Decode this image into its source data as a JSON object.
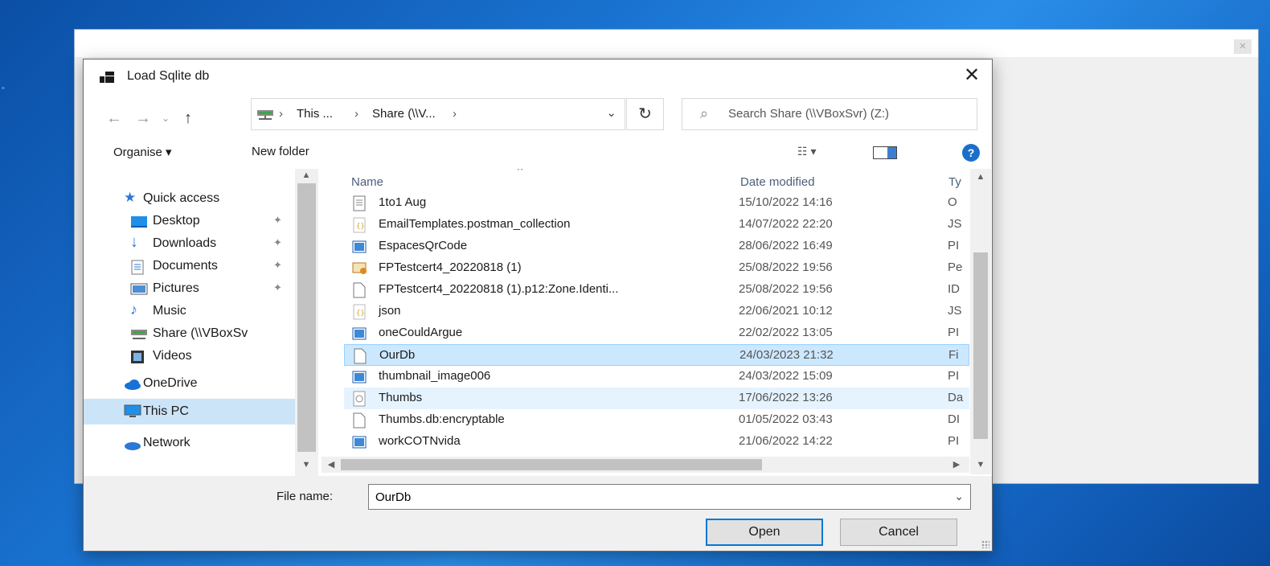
{
  "dialog": {
    "title": "Load Sqlite db",
    "address": {
      "crumbs": [
        "This ...",
        "Share (\\\\V...",
        ""
      ],
      "separator": "›"
    },
    "search": {
      "placeholder": "Search Share (\\\\VBoxSvr) (Z:)"
    },
    "toolbar": {
      "organise": "Organise ▾",
      "new_folder": "New folder"
    },
    "columns": {
      "name": "Name",
      "date": "Date modified",
      "type": "Ty"
    },
    "nav": {
      "quick_access": "Quick access",
      "items": [
        {
          "label": "Desktop",
          "icon": "desktop-icon",
          "pinned": true
        },
        {
          "label": "Downloads",
          "icon": "downloads-icon",
          "pinned": true
        },
        {
          "label": "Documents",
          "icon": "documents-icon",
          "pinned": true
        },
        {
          "label": "Pictures",
          "icon": "pictures-icon",
          "pinned": true
        },
        {
          "label": "Music",
          "icon": "music-icon",
          "pinned": false
        },
        {
          "label": "Share (\\\\VBoxSv",
          "icon": "network-drive-icon",
          "pinned": false
        },
        {
          "label": "Videos",
          "icon": "videos-icon",
          "pinned": false
        }
      ],
      "onedrive": "OneDrive",
      "this_pc": "This PC",
      "network": "Network"
    },
    "files": [
      {
        "name": "1to1 Aug",
        "date": "15/10/2022 14:16",
        "type": "O",
        "icon": "text-file-icon"
      },
      {
        "name": "EmailTemplates.postman_collection",
        "date": "14/07/2022 22:20",
        "type": "JS",
        "icon": "json-file-icon"
      },
      {
        "name": "EspacesQrCode",
        "date": "28/06/2022 16:49",
        "type": "PI",
        "icon": "image-file-icon"
      },
      {
        "name": "FPTestcert4_20220818 (1)",
        "date": "25/08/2022 19:56",
        "type": "Pe",
        "icon": "certificate-file-icon"
      },
      {
        "name": "FPTestcert4_20220818 (1).p12:Zone.Identi...",
        "date": "25/08/2022 19:56",
        "type": "ID",
        "icon": "blank-file-icon"
      },
      {
        "name": "json",
        "date": "22/06/2021 10:12",
        "type": "JS",
        "icon": "json-file-icon"
      },
      {
        "name": "oneCouldArgue",
        "date": "22/02/2022 13:05",
        "type": "PI",
        "icon": "image-file-icon"
      },
      {
        "name": "OurDb",
        "date": "24/03/2023 21:32",
        "type": "Fi",
        "icon": "blank-file-icon"
      },
      {
        "name": "thumbnail_image006",
        "date": "24/03/2022 15:09",
        "type": "PI",
        "icon": "image-file-icon"
      },
      {
        "name": "Thumbs",
        "date": "17/06/2022 13:26",
        "type": "Da",
        "icon": "database-file-icon"
      },
      {
        "name": "Thumbs.db:encryptable",
        "date": "01/05/2022 03:43",
        "type": "DI",
        "icon": "blank-file-icon"
      },
      {
        "name": "workCOTNvida",
        "date": "21/06/2022 14:22",
        "type": "PI",
        "icon": "image-file-icon"
      }
    ],
    "selected_file": "OurDb",
    "file_name_label": "File name:",
    "file_name_value": "OurDb",
    "open_label": "Open",
    "cancel_label": "Cancel",
    "colors": {
      "selection": "#cce8ff",
      "accent": "#0078d7",
      "help": "#1b6fc9"
    }
  }
}
